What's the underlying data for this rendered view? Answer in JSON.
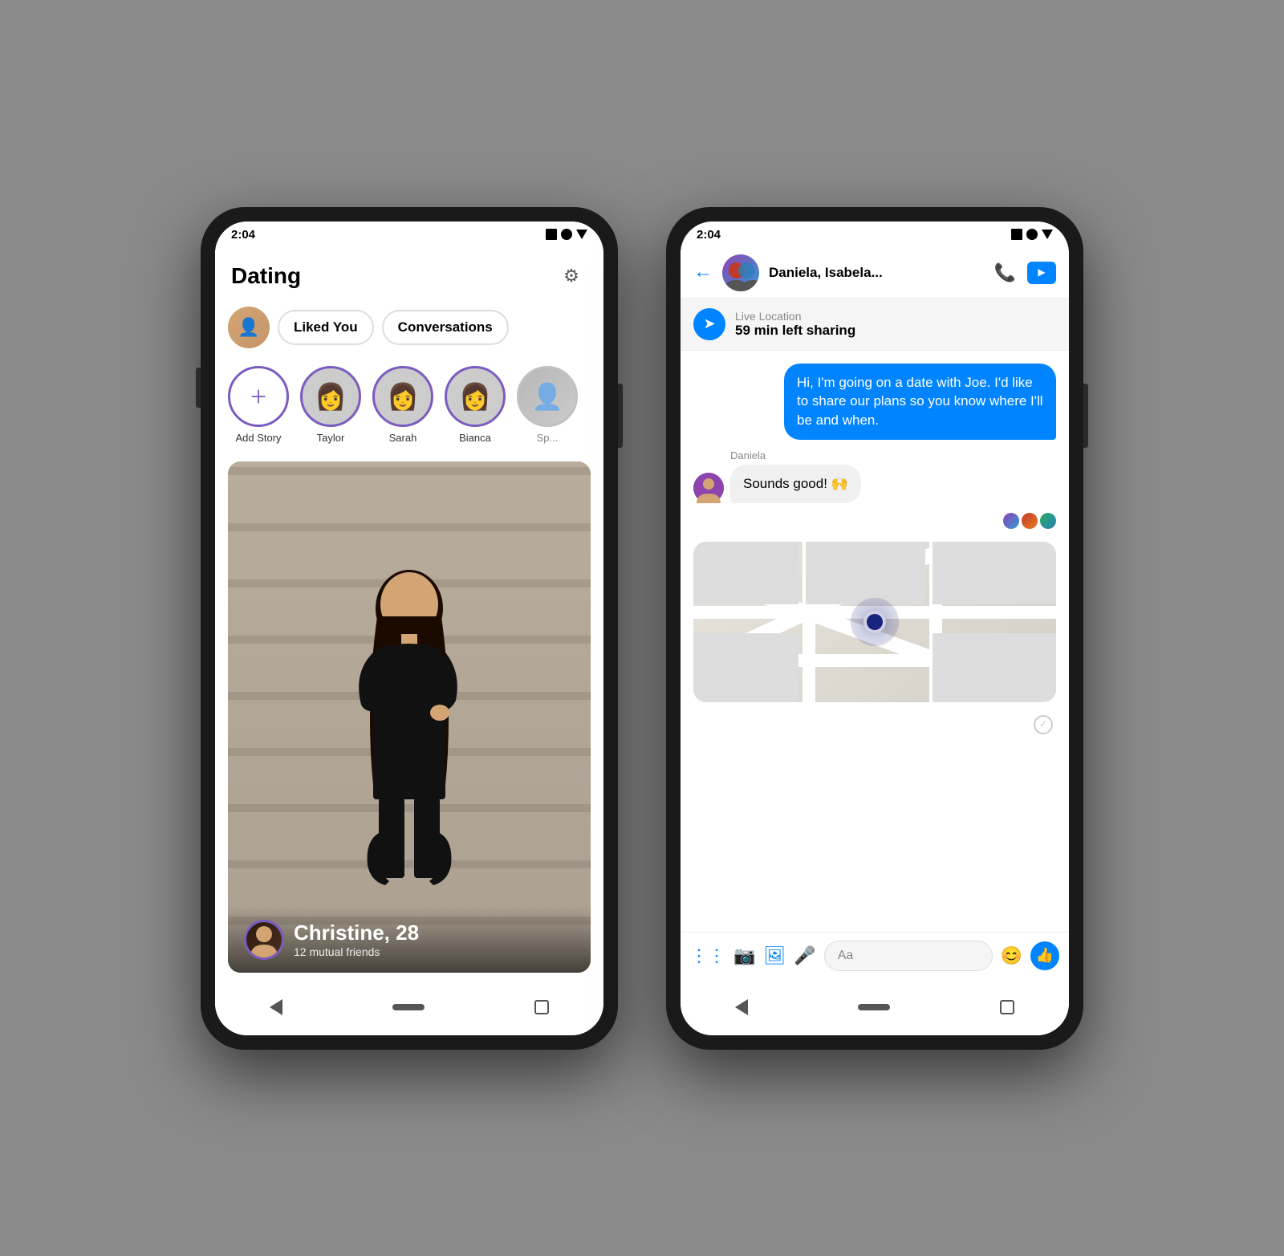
{
  "page": {
    "background": "#8a8a8a"
  },
  "left_phone": {
    "status_time": "2:04",
    "title": "Dating",
    "gear_label": "⚙",
    "tabs": {
      "liked_you": "Liked You",
      "conversations": "Conversations"
    },
    "stories": [
      {
        "name": "Add Story",
        "type": "add"
      },
      {
        "name": "Taylor",
        "type": "person"
      },
      {
        "name": "Sarah",
        "type": "person"
      },
      {
        "name": "Bianca",
        "type": "person"
      },
      {
        "name": "Sp...",
        "type": "person",
        "partial": true
      }
    ],
    "profile": {
      "name": "Christine, 28",
      "friends": "12 mutual friends"
    }
  },
  "right_phone": {
    "status_time": "2:04",
    "header": {
      "name": "Daniela, Isabela...",
      "back_label": "←"
    },
    "live_location": {
      "title": "Live Location",
      "subtitle": "59 min left sharing"
    },
    "messages": [
      {
        "type": "sent",
        "text": "Hi, I'm going on a date with Joe. I'd like to share our plans so you know where I'll be and when."
      },
      {
        "type": "received",
        "sender": "Daniela",
        "text": "Sounds good! 🙌"
      }
    ],
    "input_placeholder": "Aa"
  }
}
